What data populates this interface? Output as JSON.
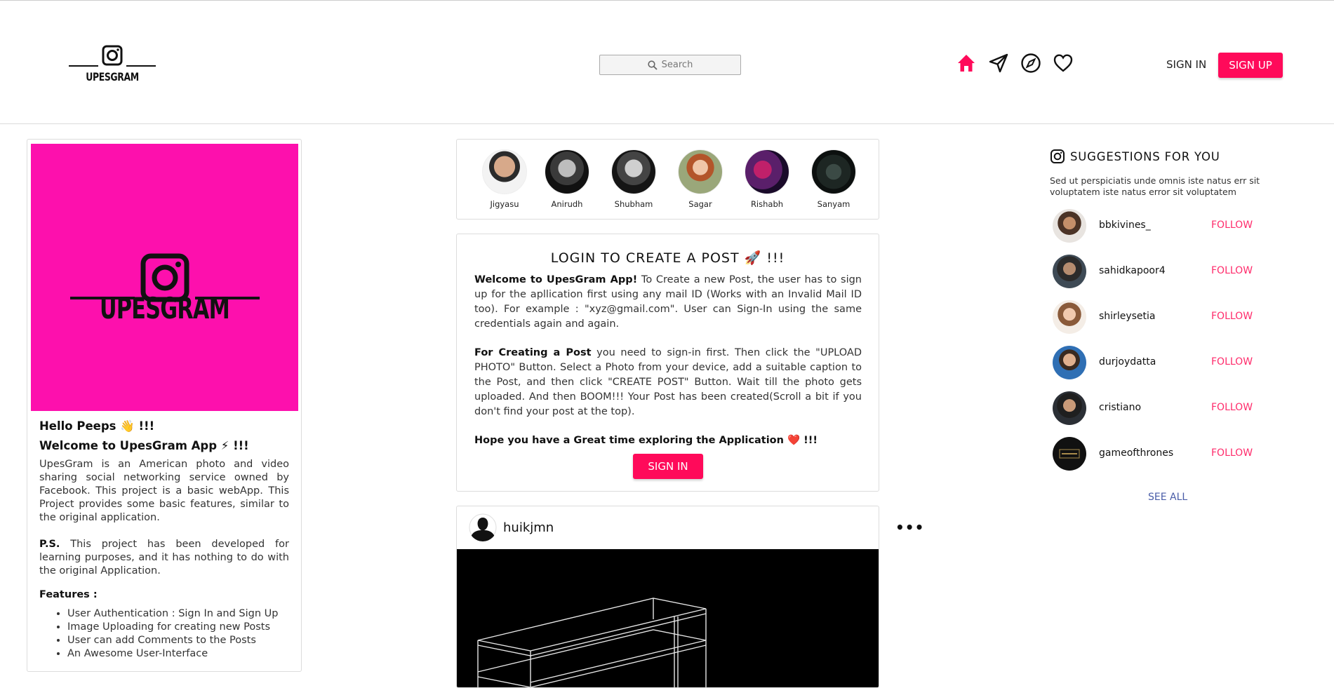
{
  "header": {
    "logo_text": "UPESGRAM",
    "search_placeholder": "Search",
    "signin_label": "SIGN IN",
    "signup_label": "SIGN UP"
  },
  "colors": {
    "accent": "#ff0a5a",
    "brand_pink": "#fd10ad",
    "follow": "#ff2b6b",
    "see_all": "#4a5da8"
  },
  "nav_icons": [
    "home-icon",
    "send-icon",
    "explore-icon",
    "heart-icon"
  ],
  "left_card": {
    "logo_text": "UPESGRAM",
    "greeting": "Hello Peeps 👋 !!!",
    "welcome": "Welcome to UpesGram App ⚡ !!!",
    "about": "UpesGram is an American photo and video sharing social networking service owned by Facebook. This project is a basic webApp. This Project provides some basic features, similar to the original application.",
    "ps_label": "P.S.",
    "ps_text": " This project has been developed for learning purposes, and it has nothing to do with the original Application.",
    "features_title": "Features :",
    "features": [
      "User Authentication : Sign In and Sign Up",
      "Image Uploading for creating new Posts",
      "User can add Comments to the Posts",
      "An Awesome User-Interface"
    ]
  },
  "stories": [
    {
      "name": "Jigyasu"
    },
    {
      "name": "Anirudh"
    },
    {
      "name": "Shubham"
    },
    {
      "name": "Sagar"
    },
    {
      "name": "Rishabh"
    },
    {
      "name": "Sanyam"
    }
  ],
  "login_card": {
    "title": "LOGIN TO CREATE A POST 🚀 !!!",
    "p1_bold": "Welcome to UpesGram App!",
    "p1_text": " To Create a new Post, the user has to sign up for the apllication first using any mail ID (Works with an Invalid Mail ID too). For example : \"xyz@gmail.com\". User can Sign-In using the same credentials again and again.",
    "p2_bold": "For Creating a Post",
    "p2_text": " you need to sign-in first. Then click the \"UPLOAD PHOTO\" Button. Select a Photo from your device, add a suitable caption to the Post, and then click \"CREATE POST\" Button. Wait till the photo gets uploaded. And then BOOM!!! Your Post has been created(Scroll a bit if you don't find your post at the top).",
    "p3_bold": "Hope you have a Great time exploring the Application ❤️ !!!",
    "signin_label": "SIGN IN"
  },
  "post": {
    "username": "huikjmn",
    "more_label": "•••"
  },
  "suggestions": {
    "title": "SUGGESTIONS FOR YOU",
    "description": "Sed ut perspiciatis unde omnis iste natus err sit voluptatem iste natus error sit voluptatem",
    "follow_label": "FOLLOW",
    "users": [
      {
        "username": "bbkivines_"
      },
      {
        "username": "sahidkapoor4"
      },
      {
        "username": "shirleysetia"
      },
      {
        "username": "durjoydatta"
      },
      {
        "username": "cristiano"
      },
      {
        "username": "gameofthrones"
      }
    ],
    "see_all_label": "SEE ALL"
  }
}
